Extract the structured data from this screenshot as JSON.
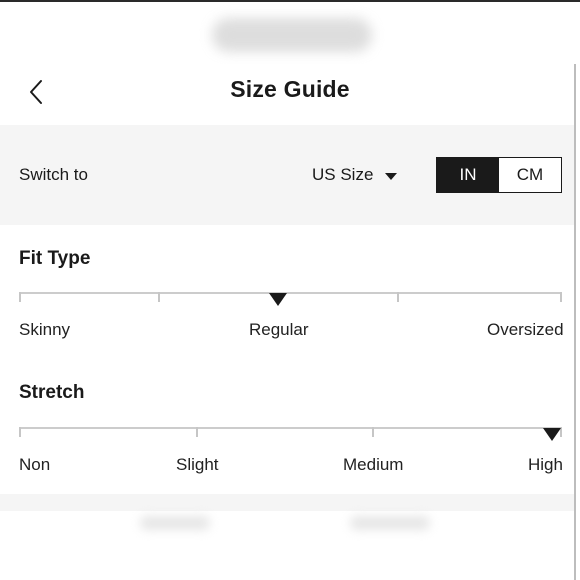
{
  "header": {
    "title": "Size Guide",
    "back_icon": "chevron-left-icon"
  },
  "switch": {
    "label": "Switch to",
    "size_system": "US Size",
    "units": [
      {
        "label": "IN",
        "active": true
      },
      {
        "label": "CM",
        "active": false
      }
    ]
  },
  "fit_type": {
    "title": "Fit Type",
    "options": [
      "Skinny",
      "Regular",
      "Oversized"
    ],
    "selected": "Regular"
  },
  "stretch": {
    "title": "Stretch",
    "options": [
      "Non",
      "Slight",
      "Medium",
      "High"
    ],
    "selected": "High"
  },
  "colors": {
    "accent": "#1a1a1a",
    "band": "#f5f5f5",
    "scale": "#cccccc"
  }
}
